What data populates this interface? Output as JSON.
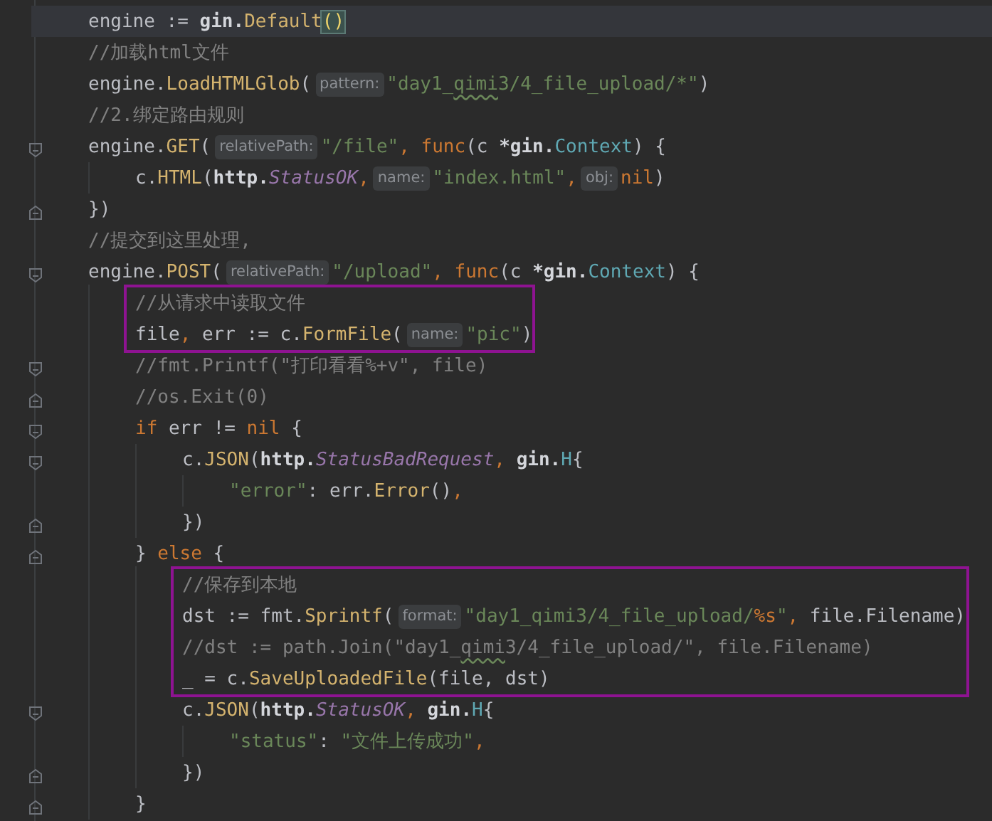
{
  "code": [
    {
      "kind": "line",
      "current": true,
      "tokens": [
        {
          "kind": "plain",
          "text": "engine := "
        },
        {
          "kind": "pkg",
          "text": "gin."
        },
        {
          "kind": "method",
          "text": "Default"
        },
        {
          "kind": "match",
          "text": "()"
        }
      ]
    },
    {
      "kind": "line",
      "tokens": [
        {
          "kind": "comment",
          "text": "//加载html文件"
        }
      ]
    },
    {
      "kind": "line",
      "tokens": [
        {
          "kind": "plain",
          "text": "engine."
        },
        {
          "kind": "method",
          "text": "LoadHTMLGlob"
        },
        {
          "kind": "plain",
          "text": "("
        },
        {
          "kind": "hint",
          "text": "pattern:"
        },
        {
          "kind": "string",
          "text": "\"day1_"
        },
        {
          "kind": "string_typo",
          "text": "qimi"
        },
        {
          "kind": "string",
          "text": "3/4_file_upload/*\""
        },
        {
          "kind": "plain",
          "text": ")"
        }
      ]
    },
    {
      "kind": "line",
      "tokens": [
        {
          "kind": "comment",
          "text": "//2.绑定路由规则"
        }
      ]
    },
    {
      "kind": "line",
      "fold_start": true,
      "tokens": [
        {
          "kind": "plain",
          "text": "engine."
        },
        {
          "kind": "method",
          "text": "GET"
        },
        {
          "kind": "plain",
          "text": "("
        },
        {
          "kind": "hint",
          "text": "relativePath:"
        },
        {
          "kind": "string",
          "text": "\"/file\""
        },
        {
          "kind": "keyword",
          "text": ", func"
        },
        {
          "kind": "plain",
          "text": "(c "
        },
        {
          "kind": "pkg",
          "text": "*gin."
        },
        {
          "kind": "type",
          "text": "Context"
        },
        {
          "kind": "plain",
          "text": ") {"
        }
      ],
      "children": [
        {
          "kind": "line",
          "tokens": [
            {
              "kind": "plain",
              "text": "c."
            },
            {
              "kind": "method",
              "text": "HTML"
            },
            {
              "kind": "plain",
              "text": "("
            },
            {
              "kind": "pkg",
              "text": "http."
            },
            {
              "kind": "constant",
              "text": "StatusOK"
            },
            {
              "kind": "keyword",
              "text": ","
            },
            {
              "kind": "hint",
              "text": "name:"
            },
            {
              "kind": "string",
              "text": "\"index.html\""
            },
            {
              "kind": "keyword",
              "text": ","
            },
            {
              "kind": "hint",
              "text": "obj:"
            },
            {
              "kind": "keyword",
              "text": "nil"
            },
            {
              "kind": "plain",
              "text": ")"
            }
          ]
        }
      ]
    },
    {
      "kind": "line",
      "fold_end": true,
      "tokens": [
        {
          "kind": "plain",
          "text": "})"
        }
      ]
    },
    {
      "kind": "line",
      "tokens": [
        {
          "kind": "comment",
          "text": "//提交到这里处理,"
        }
      ]
    },
    {
      "kind": "line",
      "fold_start": true,
      "tokens": [
        {
          "kind": "plain",
          "text": "engine."
        },
        {
          "kind": "method",
          "text": "POST"
        },
        {
          "kind": "plain",
          "text": "("
        },
        {
          "kind": "hint",
          "text": "relativePath:"
        },
        {
          "kind": "string",
          "text": "\"/upload\""
        },
        {
          "kind": "keyword",
          "text": ", func"
        },
        {
          "kind": "plain",
          "text": "(c "
        },
        {
          "kind": "pkg",
          "text": "*gin."
        },
        {
          "kind": "type",
          "text": "Context"
        },
        {
          "kind": "plain",
          "text": ") {"
        }
      ],
      "children": [
        {
          "kind": "box",
          "lines": [
            {
              "kind": "line",
              "tokens": [
                {
                  "kind": "comment",
                  "text": "//从请求中读取文件"
                }
              ]
            },
            {
              "kind": "line",
              "tokens": [
                {
                  "kind": "plain",
                  "text": "file"
                },
                {
                  "kind": "keyword",
                  "text": ","
                },
                {
                  "kind": "plain",
                  "text": " err := c."
                },
                {
                  "kind": "method",
                  "text": "FormFile"
                },
                {
                  "kind": "plain",
                  "text": "("
                },
                {
                  "kind": "hint",
                  "text": "name:"
                },
                {
                  "kind": "string",
                  "text": "\"pic\""
                },
                {
                  "kind": "plain",
                  "text": ")"
                }
              ]
            }
          ]
        },
        {
          "kind": "line",
          "fold_start": true,
          "tokens": [
            {
              "kind": "comment",
              "text": "//fmt.Printf(\"打印看看%+v\", file)"
            }
          ]
        },
        {
          "kind": "line",
          "fold_end": true,
          "tokens": [
            {
              "kind": "comment",
              "text": "//os.Exit(0)"
            }
          ]
        },
        {
          "kind": "line",
          "fold_start": true,
          "tokens": [
            {
              "kind": "keyword",
              "text": "if"
            },
            {
              "kind": "plain",
              "text": " err != "
            },
            {
              "kind": "keyword",
              "text": "nil"
            },
            {
              "kind": "plain",
              "text": " {"
            }
          ],
          "children": [
            {
              "kind": "line",
              "fold_start": true,
              "tokens": [
                {
                  "kind": "plain",
                  "text": "c."
                },
                {
                  "kind": "method",
                  "text": "JSON"
                },
                {
                  "kind": "plain",
                  "text": "("
                },
                {
                  "kind": "pkg",
                  "text": "http."
                },
                {
                  "kind": "constant",
                  "text": "StatusBadRequest"
                },
                {
                  "kind": "keyword",
                  "text": ","
                },
                {
                  "kind": "pkg",
                  "text": " gin."
                },
                {
                  "kind": "type",
                  "text": "H"
                },
                {
                  "kind": "plain",
                  "text": "{"
                }
              ],
              "children": [
                {
                  "kind": "line",
                  "tokens": [
                    {
                      "kind": "string",
                      "text": "\"error\""
                    },
                    {
                      "kind": "plain",
                      "text": ": err."
                    },
                    {
                      "kind": "method",
                      "text": "Error"
                    },
                    {
                      "kind": "plain",
                      "text": "()"
                    },
                    {
                      "kind": "keyword",
                      "text": ","
                    }
                  ]
                }
              ]
            },
            {
              "kind": "line",
              "fold_end": true,
              "tokens": [
                {
                  "kind": "plain",
                  "text": "})"
                }
              ]
            }
          ]
        },
        {
          "kind": "line",
          "fold_end": true,
          "tokens": [
            {
              "kind": "plain",
              "text": "} "
            },
            {
              "kind": "keyword",
              "text": "else"
            },
            {
              "kind": "plain",
              "text": " {"
            }
          ],
          "children": [
            {
              "kind": "box",
              "lines": [
                {
                  "kind": "line",
                  "tokens": [
                    {
                      "kind": "comment",
                      "text": "//保存到本地"
                    }
                  ]
                },
                {
                  "kind": "line",
                  "tokens": [
                    {
                      "kind": "plain",
                      "text": "dst := fmt."
                    },
                    {
                      "kind": "method",
                      "text": "Sprintf"
                    },
                    {
                      "kind": "plain",
                      "text": "("
                    },
                    {
                      "kind": "hint",
                      "text": "format:"
                    },
                    {
                      "kind": "string",
                      "text": "\"day1_qimi3/4_file_upload/"
                    },
                    {
                      "kind": "escape",
                      "text": "%s"
                    },
                    {
                      "kind": "string",
                      "text": "\""
                    },
                    {
                      "kind": "keyword",
                      "text": ","
                    },
                    {
                      "kind": "plain",
                      "text": " file.Filename)"
                    }
                  ]
                },
                {
                  "kind": "line",
                  "tokens": [
                    {
                      "kind": "comment",
                      "text": "//dst := path.Join(\"day1_"
                    },
                    {
                      "kind": "comment_typo",
                      "text": "qimi"
                    },
                    {
                      "kind": "comment",
                      "text": "3/4_file_upload/\", file.Filename)"
                    }
                  ]
                },
                {
                  "kind": "line",
                  "tokens": [
                    {
                      "kind": "plain",
                      "text": "_ = c."
                    },
                    {
                      "kind": "method",
                      "text": "SaveUploadedFile"
                    },
                    {
                      "kind": "plain",
                      "text": "(file, dst)"
                    }
                  ]
                }
              ]
            },
            {
              "kind": "line",
              "fold_start": true,
              "tokens": [
                {
                  "kind": "plain",
                  "text": "c."
                },
                {
                  "kind": "method",
                  "text": "JSON"
                },
                {
                  "kind": "plain",
                  "text": "("
                },
                {
                  "kind": "pkg",
                  "text": "http."
                },
                {
                  "kind": "constant",
                  "text": "StatusOK"
                },
                {
                  "kind": "keyword",
                  "text": ","
                },
                {
                  "kind": "pkg",
                  "text": " gin."
                },
                {
                  "kind": "type",
                  "text": "H"
                },
                {
                  "kind": "plain",
                  "text": "{"
                }
              ],
              "children": [
                {
                  "kind": "line",
                  "tokens": [
                    {
                      "kind": "string",
                      "text": "\"status\""
                    },
                    {
                      "kind": "plain",
                      "text": ": "
                    },
                    {
                      "kind": "string",
                      "text": "\"文件上传成功\""
                    },
                    {
                      "kind": "keyword",
                      "text": ","
                    }
                  ]
                }
              ]
            },
            {
              "kind": "line",
              "fold_end": true,
              "tokens": [
                {
                  "kind": "plain",
                  "text": "})"
                }
              ]
            }
          ]
        },
        {
          "kind": "line",
          "fold_end": true,
          "tokens": [
            {
              "kind": "plain",
              "text": "}"
            }
          ]
        }
      ]
    }
  ]
}
